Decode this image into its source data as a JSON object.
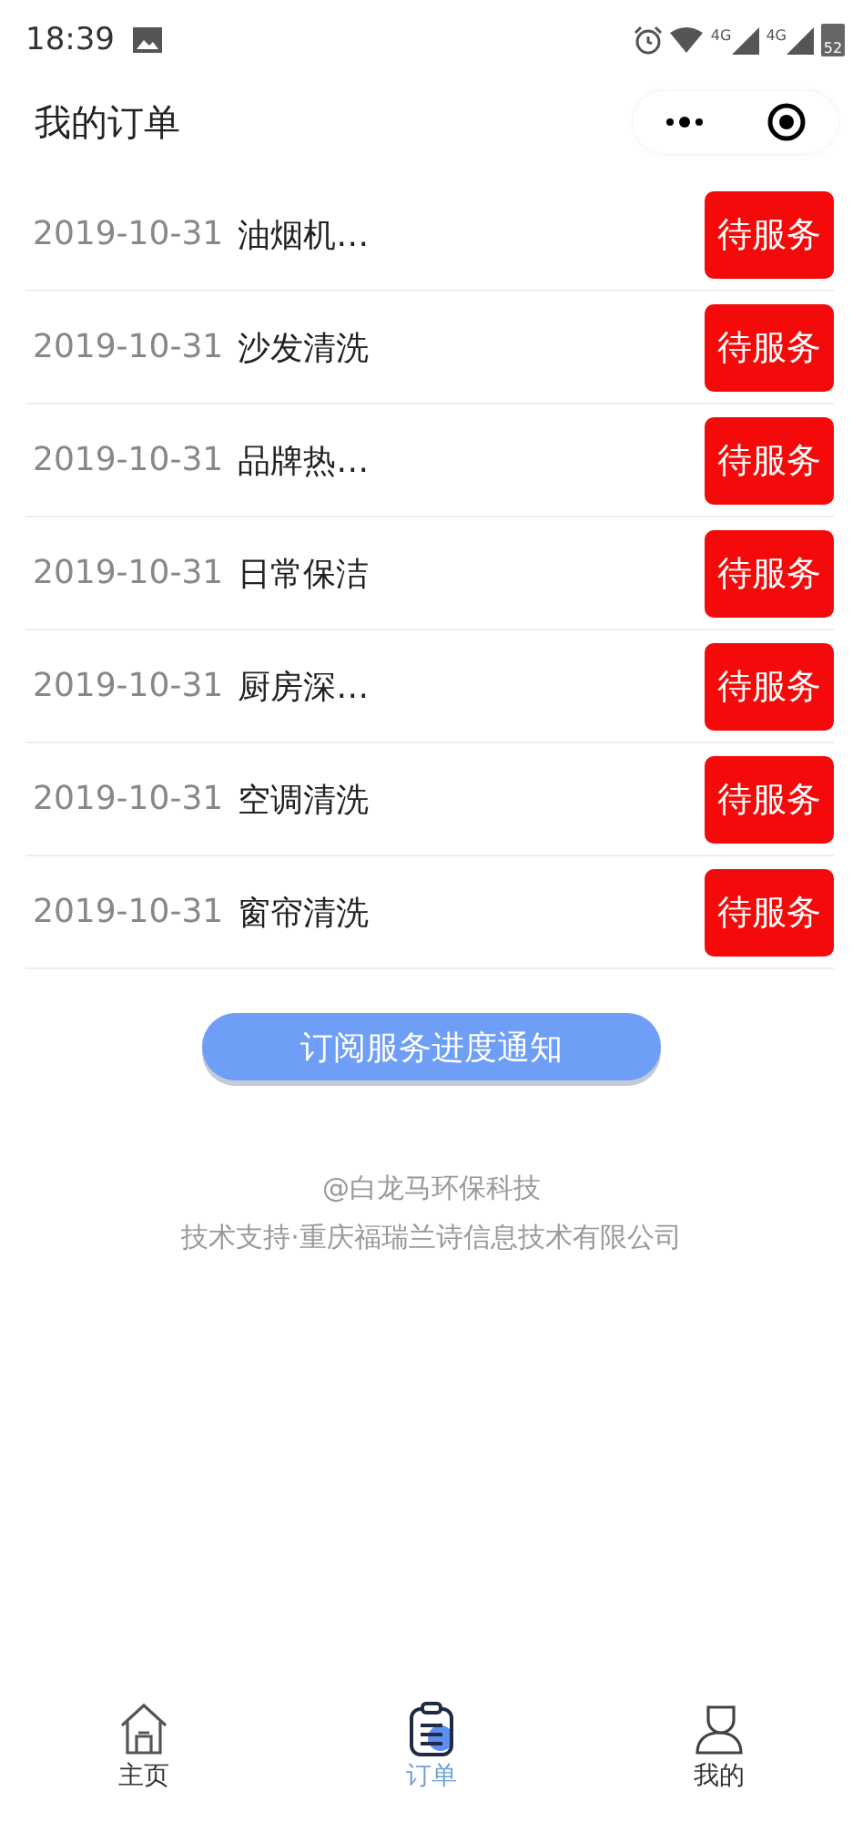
{
  "status_bar": {
    "time": "18:39",
    "network_labels": [
      "4G",
      "4G"
    ],
    "battery": "52"
  },
  "nav_bar": {
    "title": "我的订单"
  },
  "orders": [
    {
      "date": "2019-10-31",
      "name": "油烟机…",
      "status": "待服务"
    },
    {
      "date": "2019-10-31",
      "name": "沙发清洗",
      "status": "待服务"
    },
    {
      "date": "2019-10-31",
      "name": "品牌热…",
      "status": "待服务"
    },
    {
      "date": "2019-10-31",
      "name": "日常保洁",
      "status": "待服务"
    },
    {
      "date": "2019-10-31",
      "name": "厨房深…",
      "status": "待服务"
    },
    {
      "date": "2019-10-31",
      "name": "空调清洗",
      "status": "待服务"
    },
    {
      "date": "2019-10-31",
      "name": "窗帘清洗",
      "status": "待服务"
    }
  ],
  "subscribe_button": "订阅服务进度通知",
  "footer": [
    "@白龙马环保科技",
    "技术支持·重庆福瑞兰诗信息技术有限公司"
  ],
  "tabs": [
    {
      "label": "主页",
      "kind": "home",
      "selected": false
    },
    {
      "label": "订单",
      "kind": "orders",
      "selected": true
    },
    {
      "label": "我的",
      "kind": "profile",
      "selected": false
    }
  ]
}
